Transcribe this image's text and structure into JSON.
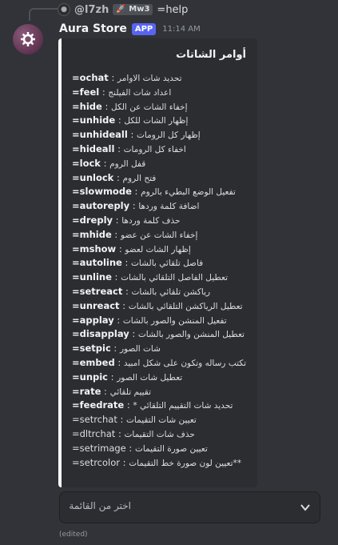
{
  "reply": {
    "user": "@l7zh",
    "badge": "🚀 Mw3",
    "text": "=help"
  },
  "message": {
    "author": "Aura Store",
    "app_badge": "APP",
    "time": "11:14 AM",
    "edited": "(edited)"
  },
  "embed": {
    "title": "أوامر الشاتات",
    "accent": "#ffffff",
    "commands": [
      {
        "key": "=ochat",
        "desc": "تحديد شات الاوامر",
        "bold": true
      },
      {
        "key": "=feel",
        "desc": "اعداد شات الفيلنج",
        "bold": true
      },
      {
        "key": "=hide",
        "desc": "إخفاء الشات عن الكل",
        "bold": true
      },
      {
        "key": "=unhide",
        "desc": "إظهار الشات للكل",
        "bold": true
      },
      {
        "key": "=unhideall",
        "desc": "إظهار كل الرومات",
        "bold": true
      },
      {
        "key": "=hideall",
        "desc": "اخفاء كل الرومات",
        "bold": true
      },
      {
        "key": "=lock",
        "desc": "قفل الروم",
        "bold": true
      },
      {
        "key": "=unlock",
        "desc": "فتح الروم",
        "bold": true
      },
      {
        "key": "=slowmode",
        "desc": "تفعيل الوضع البطيء بالروم",
        "bold": true
      },
      {
        "key": "=autoreply",
        "desc": "اضافة كلمة وردها",
        "bold": true
      },
      {
        "key": "=dreply",
        "desc": "حذف كلمة وردها",
        "bold": true
      },
      {
        "key": "=mhide",
        "desc": "إخفاء الشات عن عضو",
        "bold": true
      },
      {
        "key": "=mshow",
        "desc": "إظهار الشات لعضو",
        "bold": true
      },
      {
        "key": "=autoline",
        "desc": "فاصل تلقائي بالشات",
        "bold": true
      },
      {
        "key": "=unline",
        "desc": "تعطيل الفاصل التلقائي بالشات",
        "bold": true
      },
      {
        "key": "=setreact",
        "desc": "رياكشن تلقائي بالشات",
        "bold": true
      },
      {
        "key": "=unreact",
        "desc": "تعطيل الرياكشن التلقائي بالشات",
        "bold": true
      },
      {
        "key": "=applay",
        "desc": "تفعيل المنشن والصور بالشات",
        "bold": true
      },
      {
        "key": "=disapplay",
        "desc": "تعطيل المنشن والصور بالشات",
        "bold": true
      },
      {
        "key": "=setpic",
        "desc": "شات الصور",
        "bold": true
      },
      {
        "key": "=embed",
        "desc": "تكتب رساله وتكون على شكل امبيد",
        "bold": true
      },
      {
        "key": "=unpic",
        "desc": "تعطيل شات الصور",
        "bold": true
      },
      {
        "key": "=rate",
        "desc": "تقييم تلقائي",
        "bold": true
      },
      {
        "key": "=feedrate",
        "sep": " : ",
        "desc": "* تحديد شات التقييم التلقائي",
        "bold": true
      },
      {
        "key": "=setrchat",
        "desc": "تعيين شات التقيمات",
        "bold": false
      },
      {
        "key": "=dltrchat",
        "desc": "حذف شات التقيمات",
        "bold": false
      },
      {
        "key": "=setrimage",
        "desc": "تعيين صورة التقيمات",
        "bold": false
      },
      {
        "key": "=setrcolor",
        "desc": "تعيين لون صورة خط التقيمات**",
        "bold": false
      }
    ]
  },
  "select_menu": {
    "placeholder": "اختر من القائمة"
  }
}
